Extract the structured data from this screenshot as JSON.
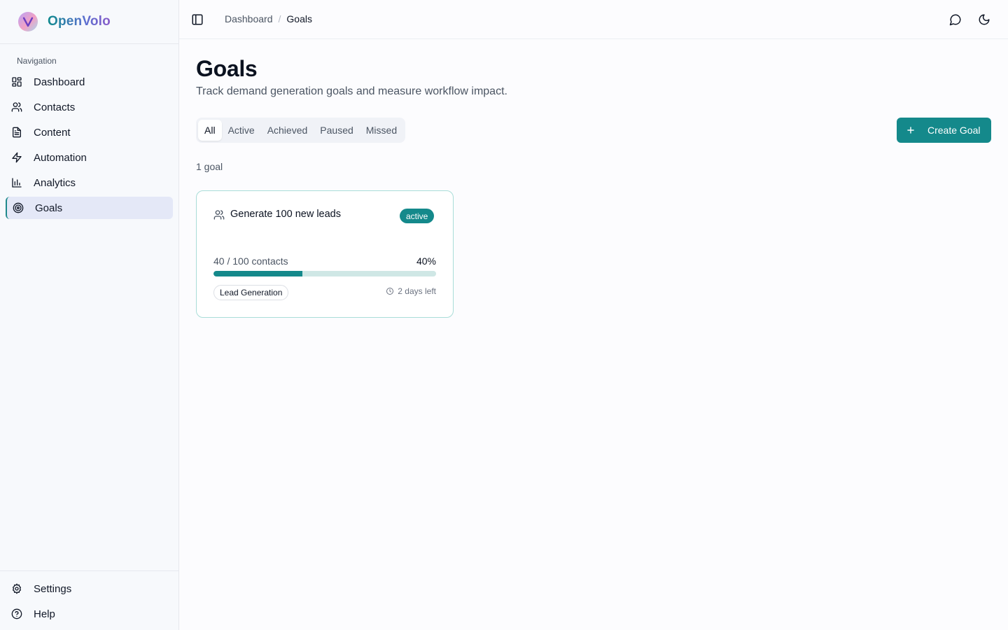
{
  "brand": {
    "name": "OpenVolo"
  },
  "sidebar": {
    "section_label": "Navigation",
    "items": [
      {
        "label": "Dashboard",
        "icon": "dashboard-icon"
      },
      {
        "label": "Contacts",
        "icon": "users-icon"
      },
      {
        "label": "Content",
        "icon": "document-icon"
      },
      {
        "label": "Automation",
        "icon": "zap-icon"
      },
      {
        "label": "Analytics",
        "icon": "bar-chart-icon"
      },
      {
        "label": "Goals",
        "icon": "target-icon",
        "active": true
      }
    ],
    "bottom_items": [
      {
        "label": "Settings",
        "icon": "gear-icon"
      },
      {
        "label": "Help",
        "icon": "help-circle-icon"
      }
    ]
  },
  "header": {
    "breadcrumb": {
      "parent": "Dashboard",
      "separator": "/",
      "current": "Goals"
    }
  },
  "main": {
    "title": "Goals",
    "subtitle": "Track demand generation goals and measure workflow impact.",
    "tabs": [
      "All",
      "Active",
      "Achieved",
      "Paused",
      "Missed"
    ],
    "active_tab": "All",
    "create_button": "Create Goal",
    "count_text": "1 goal"
  },
  "goal_card": {
    "title": "Generate 100 new leads",
    "status": "active",
    "progress_text": "40 / 100 contacts",
    "percent_text": "40%",
    "progress_fraction": 0.4,
    "tag": "Lead Generation",
    "time_left": "2 days left"
  },
  "colors": {
    "accent": "#14898b",
    "active_nav_bg": "#e4e8f7",
    "progress_track": "#cfe7e5",
    "card_border": "#a9ddd8"
  }
}
